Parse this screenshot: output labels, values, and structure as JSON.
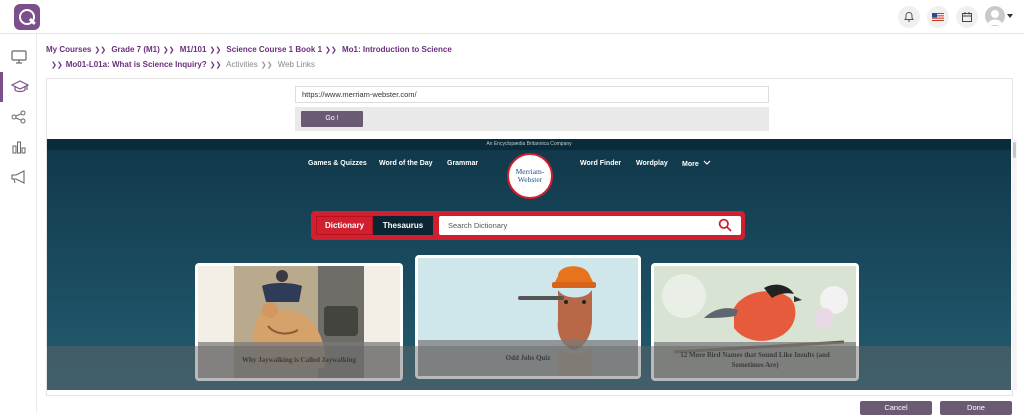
{
  "breadcrumb": {
    "items": [
      "My Courses",
      "Grade 7 (M1)",
      "M1/101",
      "Science Course 1 Book 1",
      "Mo1: Introduction to Science",
      "Mo01-L01a: What is Science Inquiry?"
    ],
    "trail": [
      "Activities",
      "Web Links"
    ]
  },
  "weblink": {
    "url": "https://www.merriam-webster.com/",
    "go_label": "Go !"
  },
  "site": {
    "topline": "An Encyclopædia Britannica Company",
    "nav_left": [
      "Games & Quizzes",
      "Word of the Day",
      "Grammar"
    ],
    "nav_right": [
      "Word Finder",
      "Wordplay",
      "More"
    ],
    "logo_line1": "Merriam-",
    "logo_line2": "Webster",
    "tab_dictionary": "Dictionary",
    "tab_thesaurus": "Thesaurus",
    "search_placeholder": "Search Dictionary",
    "cards": [
      {
        "title": "Why Jaywalking is Called Jaywalking"
      },
      {
        "title": "Odd Jobs Quiz"
      },
      {
        "title": "12 More Bird Names that Sound Like Insults (and Sometimes Are)"
      }
    ]
  },
  "footer": {
    "cancel_label": "Cancel",
    "done_label": "Done"
  },
  "colors": {
    "brand": "#7a4f8c",
    "mw_red": "#d01f2f",
    "mw_blue": "#0f3a4c"
  }
}
